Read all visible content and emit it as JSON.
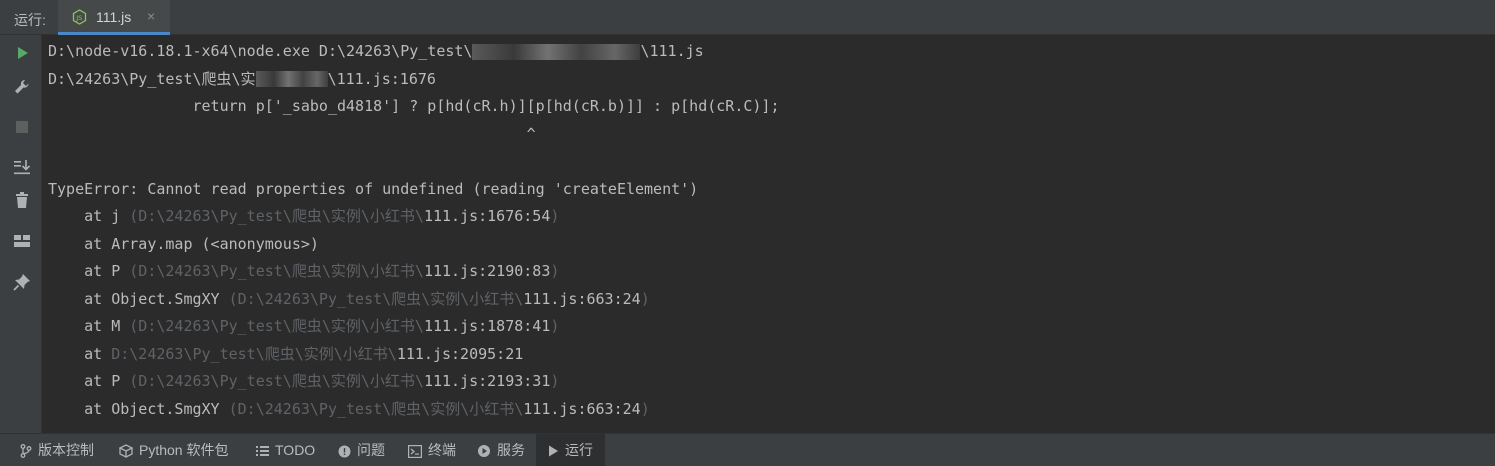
{
  "window": {
    "run_label": "运行:"
  },
  "tab": {
    "title": "111.js",
    "close": "×",
    "icon": "nodejs-icon"
  },
  "toolbar": {
    "items": [
      {
        "name": "run-icon",
        "color": "#59a869"
      },
      {
        "name": "wrench-icon"
      },
      {
        "name": "stop-icon"
      },
      {
        "name": "scroll-to-end-icon"
      },
      {
        "name": "trash-icon"
      },
      {
        "name": "layout-icon"
      },
      {
        "name": "pin-icon"
      }
    ]
  },
  "console": {
    "cmd_prefix": "D:\\node-v16.18.1-x64\\node.exe D:\\24263\\Py_test\\",
    "cmd_suffix": "\\111.js",
    "err_loc_prefix": "D:\\24263\\Py_test\\爬虫\\实",
    "err_loc_suffix": "\\111.js:1676",
    "code_line": "                return p['_sabo_d4818'] ? p[hd(cR.h)][p[hd(cR.b)]] : p[hd(cR.C)];",
    "caret_line": "                                                     ^",
    "error_message": "TypeError: Cannot read properties of undefined (reading 'createElement')",
    "stack": [
      {
        "prefix": "    at j ",
        "path": "(D:\\24263\\Py_test\\爬虫\\实例\\小红书\\",
        "file": "111.js:1676:54",
        "end": ")"
      },
      {
        "prefix": "    at Array.map (<anonymous>)",
        "path": "",
        "file": "",
        "end": ""
      },
      {
        "prefix": "    at P ",
        "path": "(D:\\24263\\Py_test\\爬虫\\实例\\小红书\\",
        "file": "111.js:2190:83",
        "end": ")"
      },
      {
        "prefix": "    at Object.SmgXY ",
        "path": "(D:\\24263\\Py_test\\爬虫\\实例\\小红书\\",
        "file": "111.js:663:24",
        "end": ")"
      },
      {
        "prefix": "    at M ",
        "path": "(D:\\24263\\Py_test\\爬虫\\实例\\小红书\\",
        "file": "111.js:1878:41",
        "end": ")"
      },
      {
        "prefix": "    at ",
        "path": "D:\\24263\\Py_test\\爬虫\\实例\\小红书\\",
        "file": "111.js:2095:21",
        "end": ""
      },
      {
        "prefix": "    at P ",
        "path": "(D:\\24263\\Py_test\\爬虫\\实例\\小红书\\",
        "file": "111.js:2193:31",
        "end": ")"
      },
      {
        "prefix": "    at Object.SmgXY ",
        "path": "(D:\\24263\\Py_test\\爬虫\\实例\\小红书\\",
        "file": "111.js:663:24",
        "end": ")"
      }
    ]
  },
  "statusbar": {
    "items": [
      {
        "label": "版本控制",
        "icon": "branch-icon"
      },
      {
        "label": "Python 软件包",
        "icon": "package-icon"
      },
      {
        "label": "TODO",
        "icon": "list-icon"
      },
      {
        "label": "问题",
        "icon": "info-icon"
      },
      {
        "label": "终端",
        "icon": "terminal-icon"
      },
      {
        "label": "服务",
        "icon": "services-icon"
      },
      {
        "label": "运行",
        "icon": "play-icon",
        "active": true
      }
    ]
  },
  "colors": {
    "accent": "#4a88c7",
    "run_green": "#59a869",
    "background": "#2b2b2b",
    "dim_path": "#5f6266"
  }
}
